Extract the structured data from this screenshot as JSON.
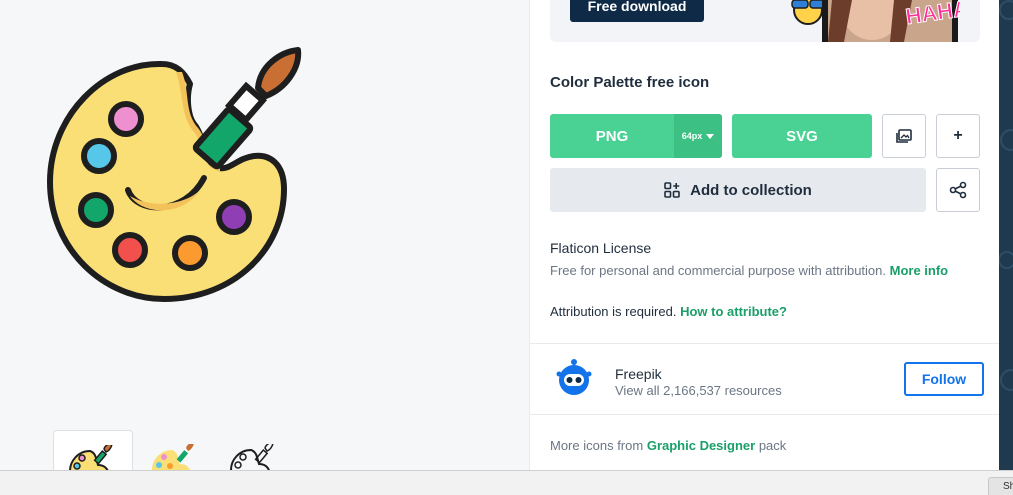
{
  "promo": {
    "button_label": "Free download",
    "sticker_text": "HAHA"
  },
  "icon": {
    "title": "Color Palette free icon",
    "main_image": "color-palette-icon"
  },
  "thumbnails": [
    {
      "name": "color-palette-lineal-color-thumbnail",
      "selected": true
    },
    {
      "name": "color-palette-flat-thumbnail",
      "selected": false
    },
    {
      "name": "color-palette-outline-thumbnail",
      "selected": false
    }
  ],
  "download": {
    "png_label": "PNG",
    "size_label": "64px",
    "svg_label": "SVG",
    "image_icon": "image-icon",
    "plus_label": "+"
  },
  "collection": {
    "label": "Add to collection",
    "icon": "add-grid-icon"
  },
  "share": {
    "icon": "share-icon"
  },
  "license": {
    "title": "Flaticon License",
    "description": "Free for personal and commercial purpose with attribution.",
    "more_info": "More info",
    "attribution_text": "Attribution is required.",
    "attribution_link": "How to attribute?"
  },
  "author": {
    "name": "Freepik",
    "resources": "View all 2,166,537 resources",
    "follow_label": "Follow"
  },
  "pack": {
    "prefix": "More icons from",
    "name": "Graphic Designer",
    "suffix": "pack"
  },
  "bottom_bar": {
    "chip_text": "Sh"
  },
  "colors": {
    "green": "#4ad295",
    "green_dark": "#3cc083",
    "navy": "#0e2a47",
    "link_green": "#1a9f6a",
    "follow_blue": "#1273eb",
    "palette_yellow": "#fadf77"
  }
}
